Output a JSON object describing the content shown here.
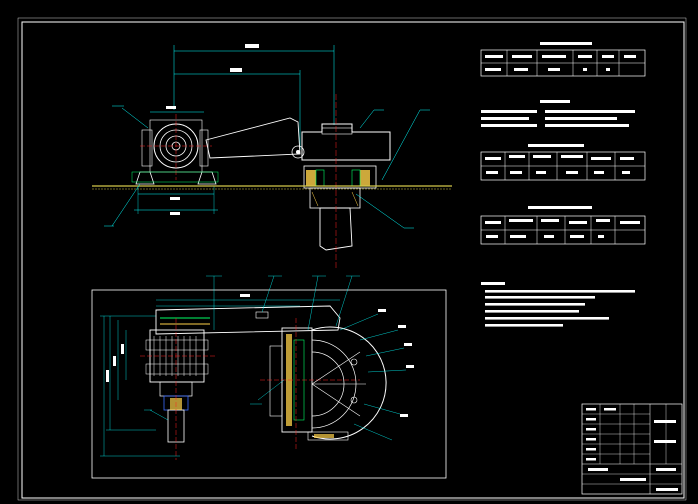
{
  "drawing": {
    "tables": [
      {
        "title": "",
        "headers": [
          "",
          "",
          "",
          "",
          ""
        ],
        "values": [
          "",
          "",
          "",
          "",
          ""
        ]
      },
      {
        "title": "",
        "headers": [
          "",
          "",
          "",
          "",
          ""
        ],
        "values": [
          "",
          "",
          "",
          "",
          ""
        ]
      },
      {
        "title": "",
        "headers": [
          "",
          "",
          "",
          "",
          ""
        ],
        "values": [
          "",
          "",
          "",
          "",
          ""
        ]
      }
    ],
    "notes_title": "",
    "notes": [
      "",
      "",
      "",
      "",
      "",
      ""
    ],
    "title_block": {
      "title": "",
      "drawing_no": ""
    }
  },
  "colors": {
    "background": "#000000",
    "frame": "#ffffff",
    "dimension": "#00ffff",
    "leader": "#00ffff",
    "centerline": "#ff2020",
    "part": "#ffffff",
    "ground": "#d4c84a",
    "hatch": "#ffd24a",
    "accent": "#00ff66",
    "hidden": "#3a6bff"
  }
}
